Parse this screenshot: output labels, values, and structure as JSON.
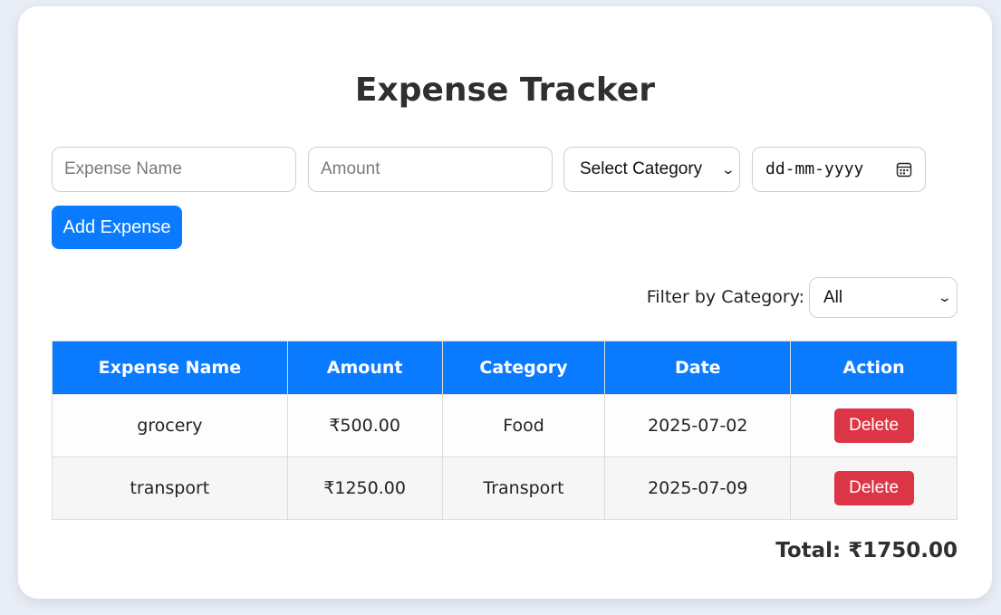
{
  "app": {
    "title": "Expense Tracker"
  },
  "form": {
    "name_placeholder": "Expense Name",
    "amount_placeholder": "Amount",
    "category_selected": "Select Category",
    "date_placeholder": "dd-mm-yyyy",
    "add_button_label": "Add Expense"
  },
  "filter": {
    "label": "Filter by Category:",
    "selected": "All"
  },
  "table": {
    "headers": [
      "Expense Name",
      "Amount",
      "Category",
      "Date",
      "Action"
    ],
    "rows": [
      {
        "name": "grocery",
        "amount": "₹500.00",
        "category": "Food",
        "date": "2025-07-02",
        "action": "Delete"
      },
      {
        "name": "transport",
        "amount": "₹1250.00",
        "category": "Transport",
        "date": "2025-07-09",
        "action": "Delete"
      }
    ]
  },
  "summary": {
    "total": "Total: ₹1750.00"
  },
  "colors": {
    "primary": "#0a7bff",
    "danger": "#dc3545",
    "background": "#e9eef6",
    "card": "#ffffff"
  },
  "icons": {
    "calendar": "calendar-icon",
    "select_arrow": "chevron-down-icon"
  }
}
